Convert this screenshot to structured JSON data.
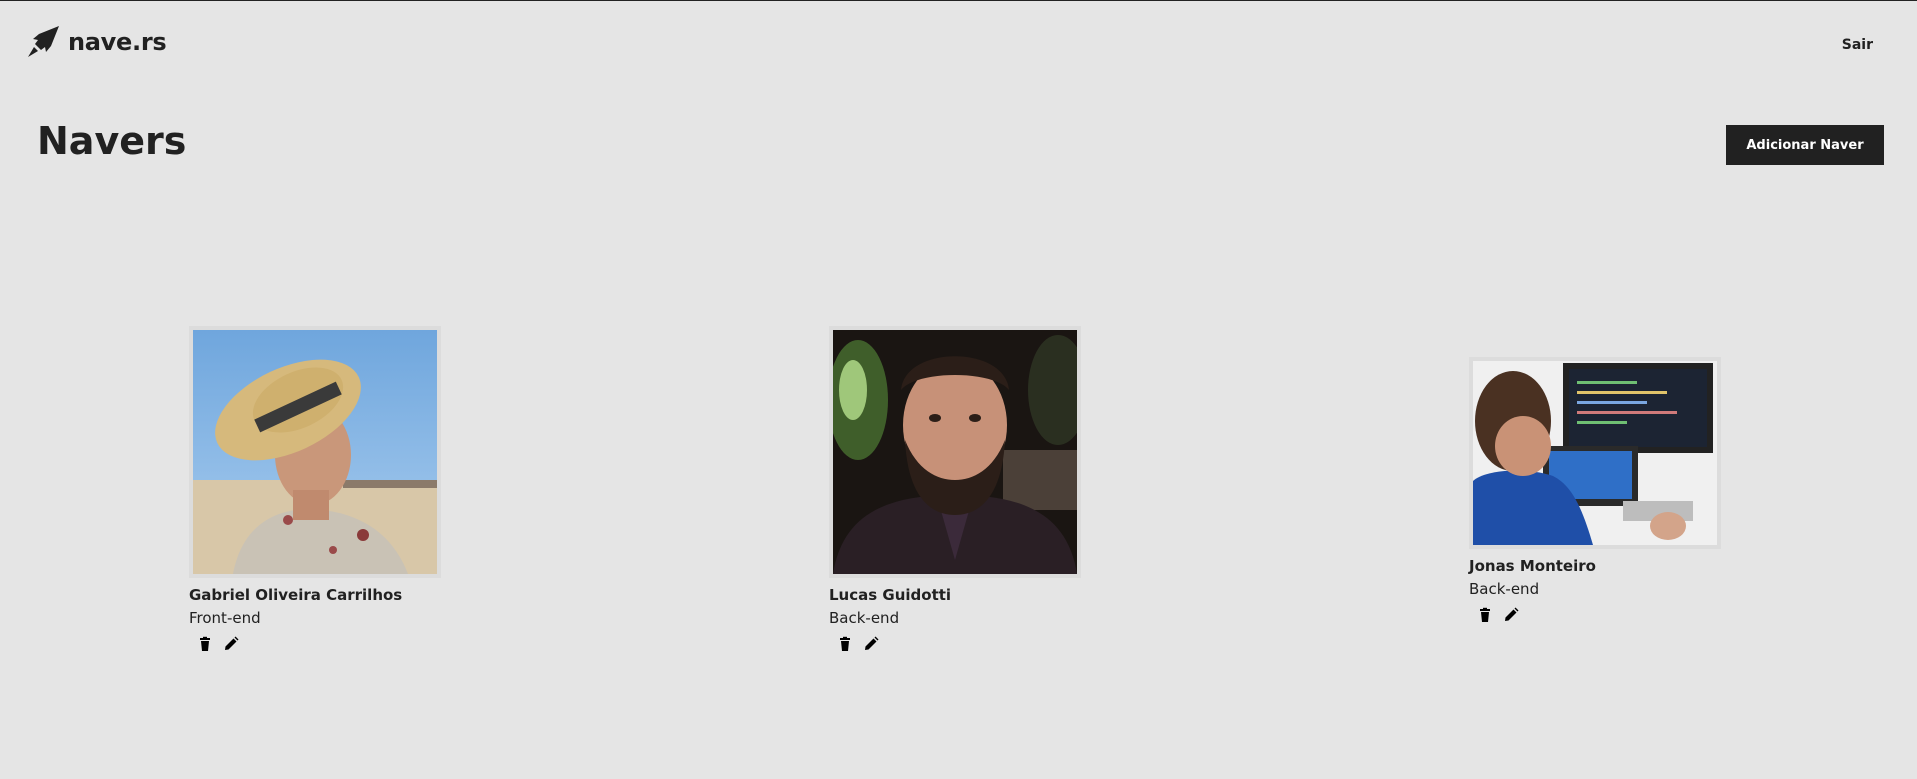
{
  "header": {
    "logo_text": "nave.rs",
    "logout_label": "Sair"
  },
  "main": {
    "title": "Navers",
    "add_button_label": "Adicionar Naver"
  },
  "navers": [
    {
      "name": "Gabriel Oliveira Carrilhos",
      "role": "Front-end"
    },
    {
      "name": "Lucas Guidotti",
      "role": "Back-end"
    },
    {
      "name": "Jonas Monteiro",
      "role": "Back-end"
    }
  ],
  "icons": {
    "logo": "rocket-icon",
    "delete": "trash-icon",
    "edit": "pencil-icon"
  },
  "colors": {
    "background": "#e5e5e5",
    "primary": "#212121",
    "button_text": "#ffffff"
  }
}
